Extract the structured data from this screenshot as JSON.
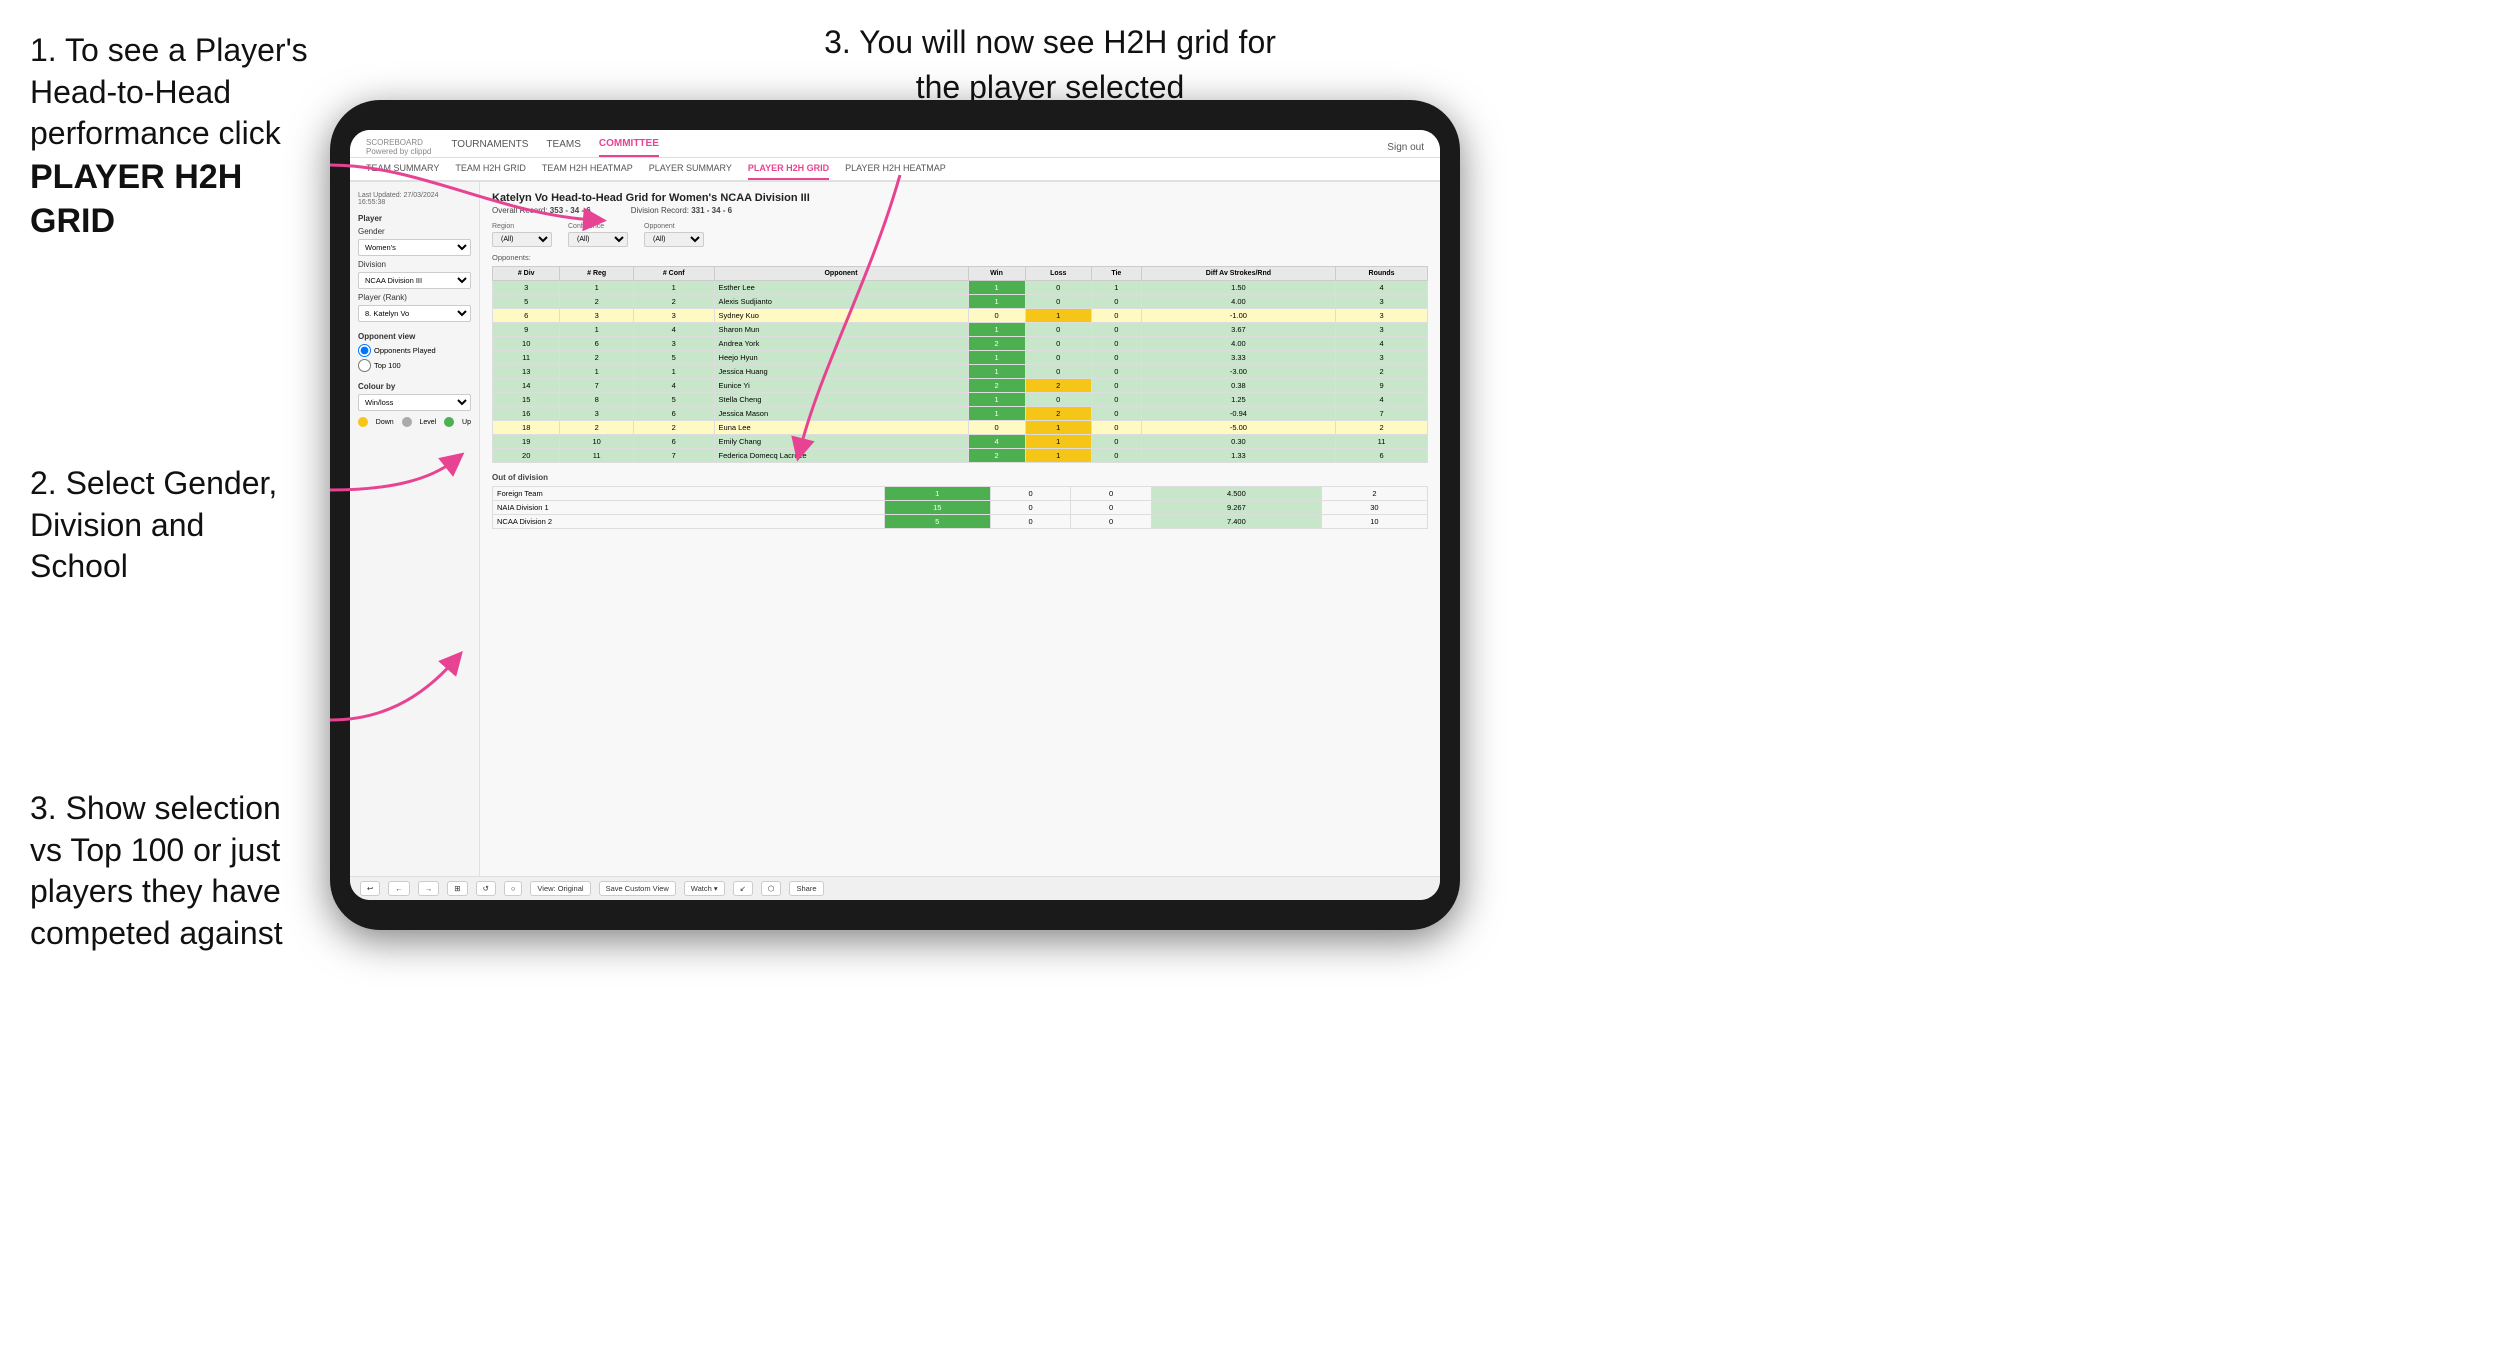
{
  "instructions": {
    "step1": {
      "text": "1. To see a Player's Head-to-Head performance click",
      "bold": "PLAYER H2H GRID"
    },
    "step2": {
      "text": "2. Select Gender, Division and School"
    },
    "step3_left": {
      "text": "3. Show selection vs Top 100 or just players they have competed against"
    },
    "step3_right": {
      "text": "3. You will now see H2H grid for the player selected"
    }
  },
  "nav": {
    "logo": "SCOREBOARD",
    "logo_sub": "Powered by clippd",
    "links": [
      "TOURNAMENTS",
      "TEAMS",
      "COMMITTEE"
    ],
    "active_link": "COMMITTEE",
    "sign_out": "Sign out"
  },
  "sub_nav": {
    "links": [
      "TEAM SUMMARY",
      "TEAM H2H GRID",
      "TEAM H2H HEATMAP",
      "PLAYER SUMMARY",
      "PLAYER H2H GRID",
      "PLAYER H2H HEATMAP"
    ],
    "active": "PLAYER H2H GRID"
  },
  "sidebar": {
    "last_updated": "Last Updated: 27/03/2024",
    "time": "16:55:38",
    "sections": {
      "player": {
        "label": "Player",
        "gender_label": "Gender",
        "gender_value": "Women's",
        "division_label": "Division",
        "division_value": "NCAA Division III",
        "player_rank_label": "Player (Rank)",
        "player_rank_value": "8. Katelyn Vo"
      },
      "opponent_view": {
        "label": "Opponent view",
        "options": [
          "Opponents Played",
          "Top 100"
        ],
        "selected": "Opponents Played"
      },
      "colour_by": {
        "label": "Colour by",
        "value": "Win/loss",
        "legend": [
          {
            "label": "Down",
            "color": "yellow"
          },
          {
            "label": "Level",
            "color": "gray"
          },
          {
            "label": "Up",
            "color": "green"
          }
        ]
      }
    }
  },
  "grid": {
    "title": "Katelyn Vo Head-to-Head Grid for Women's NCAA Division III",
    "overall_record": "353 - 34 - 6",
    "division_record": "331 - 34 - 6",
    "region_filter": "(All)",
    "conference_filter": "(All)",
    "opponent_filter": "(All)",
    "opponents_label": "Opponents:",
    "columns": [
      "# Div",
      "# Reg",
      "# Conf",
      "Opponent",
      "Win",
      "Loss",
      "Tie",
      "Diff Av Strokes/Rnd",
      "Rounds"
    ],
    "rows": [
      {
        "div": "3",
        "reg": "1",
        "conf": "1",
        "opponent": "Esther Lee",
        "win": 1,
        "loss": 0,
        "tie": 1,
        "diff": "1.50",
        "rounds": 4,
        "color": "green"
      },
      {
        "div": "5",
        "reg": "2",
        "conf": "2",
        "opponent": "Alexis Sudjianto",
        "win": 1,
        "loss": 0,
        "tie": 0,
        "diff": "4.00",
        "rounds": 3,
        "color": "green"
      },
      {
        "div": "6",
        "reg": "3",
        "conf": "3",
        "opponent": "Sydney Kuo",
        "win": 0,
        "loss": 1,
        "tie": 0,
        "diff": "-1.00",
        "rounds": 3,
        "color": "yellow"
      },
      {
        "div": "9",
        "reg": "1",
        "conf": "4",
        "opponent": "Sharon Mun",
        "win": 1,
        "loss": 0,
        "tie": 0,
        "diff": "3.67",
        "rounds": 3,
        "color": "green"
      },
      {
        "div": "10",
        "reg": "6",
        "conf": "3",
        "opponent": "Andrea York",
        "win": 2,
        "loss": 0,
        "tie": 0,
        "diff": "4.00",
        "rounds": 4,
        "color": "green"
      },
      {
        "div": "11",
        "reg": "2",
        "conf": "5",
        "opponent": "Heejo Hyun",
        "win": 1,
        "loss": 0,
        "tie": 0,
        "diff": "3.33",
        "rounds": 3,
        "color": "green"
      },
      {
        "div": "13",
        "reg": "1",
        "conf": "1",
        "opponent": "Jessica Huang",
        "win": 1,
        "loss": 0,
        "tie": 0,
        "diff": "-3.00",
        "rounds": 2,
        "color": "green"
      },
      {
        "div": "14",
        "reg": "7",
        "conf": "4",
        "opponent": "Eunice Yi",
        "win": 2,
        "loss": 2,
        "tie": 0,
        "diff": "0.38",
        "rounds": 9,
        "color": "green"
      },
      {
        "div": "15",
        "reg": "8",
        "conf": "5",
        "opponent": "Stella Cheng",
        "win": 1,
        "loss": 0,
        "tie": 0,
        "diff": "1.25",
        "rounds": 4,
        "color": "green"
      },
      {
        "div": "16",
        "reg": "3",
        "conf": "6",
        "opponent": "Jessica Mason",
        "win": 1,
        "loss": 2,
        "tie": 0,
        "diff": "-0.94",
        "rounds": 7,
        "color": "green"
      },
      {
        "div": "18",
        "reg": "2",
        "conf": "2",
        "opponent": "Euna Lee",
        "win": 0,
        "loss": 1,
        "tie": 0,
        "diff": "-5.00",
        "rounds": 2,
        "color": "yellow"
      },
      {
        "div": "19",
        "reg": "10",
        "conf": "6",
        "opponent": "Emily Chang",
        "win": 4,
        "loss": 1,
        "tie": 0,
        "diff": "0.30",
        "rounds": 11,
        "color": "green"
      },
      {
        "div": "20",
        "reg": "11",
        "conf": "7",
        "opponent": "Federica Domecq Lacroze",
        "win": 2,
        "loss": 1,
        "tie": 0,
        "diff": "1.33",
        "rounds": 6,
        "color": "green"
      }
    ],
    "out_of_division": {
      "label": "Out of division",
      "rows": [
        {
          "name": "Foreign Team",
          "win": 1,
          "loss": 0,
          "tie": 0,
          "diff": "4.500",
          "rounds": 2,
          "color": "green"
        },
        {
          "name": "NAIA Division 1",
          "win": 15,
          "loss": 0,
          "tie": 0,
          "diff": "9.267",
          "rounds": 30,
          "color": "green"
        },
        {
          "name": "NCAA Division 2",
          "win": 5,
          "loss": 0,
          "tie": 0,
          "diff": "7.400",
          "rounds": 10,
          "color": "green"
        }
      ]
    }
  },
  "toolbar": {
    "buttons": [
      "↩",
      "←",
      "→",
      "⊞",
      "↺",
      "○",
      "View: Original",
      "Save Custom View",
      "Watch ▾",
      "↙",
      "⬡",
      "Share"
    ]
  }
}
